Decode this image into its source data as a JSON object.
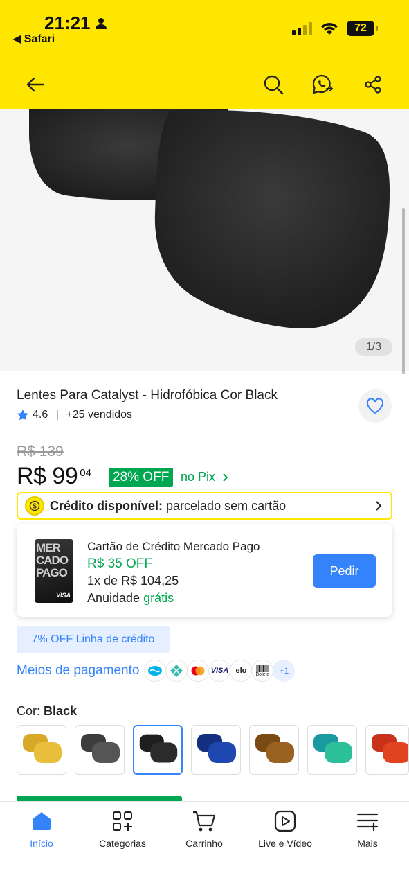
{
  "status_bar": {
    "time": "21:21",
    "back_app": "Safari",
    "battery": "72"
  },
  "colors": {
    "brand_yellow": "#FFE600",
    "accent_blue": "#3483FA",
    "success_green": "#00A650"
  },
  "toolbar": {
    "icons": [
      "back-arrow-icon",
      "search-icon",
      "whatsapp-share-icon",
      "share-icon"
    ]
  },
  "gallery": {
    "counter": "1/3"
  },
  "product": {
    "title": "Lentes Para Catalyst - Hidrofóbica Cor Black",
    "rating": "4.6",
    "sold": "+25 vendidos",
    "old_price": "R$ 139",
    "price": "R$ 99",
    "price_cents": "04",
    "discount": "28% OFF",
    "pix_label": "no Pix"
  },
  "credit": {
    "label": "Crédito disponível:",
    "text": "parcelado sem cartão"
  },
  "card_offer": {
    "card_art_text": "MERCADO PAGO",
    "card_brand": "VISA",
    "title": "Cartão de Crédito Mercado Pago",
    "off": "R$ 35 OFF",
    "installments": "1x de R$ 104,25",
    "annual_fee_prefix": "Anuidade",
    "annual_fee_value": "grátis",
    "button": "Pedir"
  },
  "credit_line_tag": "7% OFF Linha de crédito",
  "payment": {
    "link": "Meios de pagamento",
    "methods": [
      "mercado-pago-icon",
      "pix-icon",
      "mastercard-icon",
      "VISA",
      "elo",
      "Boleto"
    ],
    "more": "+1"
  },
  "color_selector": {
    "label": "Cor:",
    "selected": "Black",
    "options": [
      "gold",
      "smoke",
      "black",
      "blue",
      "bronze",
      "emerald",
      "red"
    ]
  },
  "bottom_nav": {
    "items": [
      {
        "label": "Início",
        "icon": "home-icon"
      },
      {
        "label": "Categorias",
        "icon": "categories-icon"
      },
      {
        "label": "Carrinho",
        "icon": "cart-icon"
      },
      {
        "label": "Live e Vídeo",
        "icon": "video-icon"
      },
      {
        "label": "Mais",
        "icon": "menu-plus-icon"
      }
    ]
  }
}
